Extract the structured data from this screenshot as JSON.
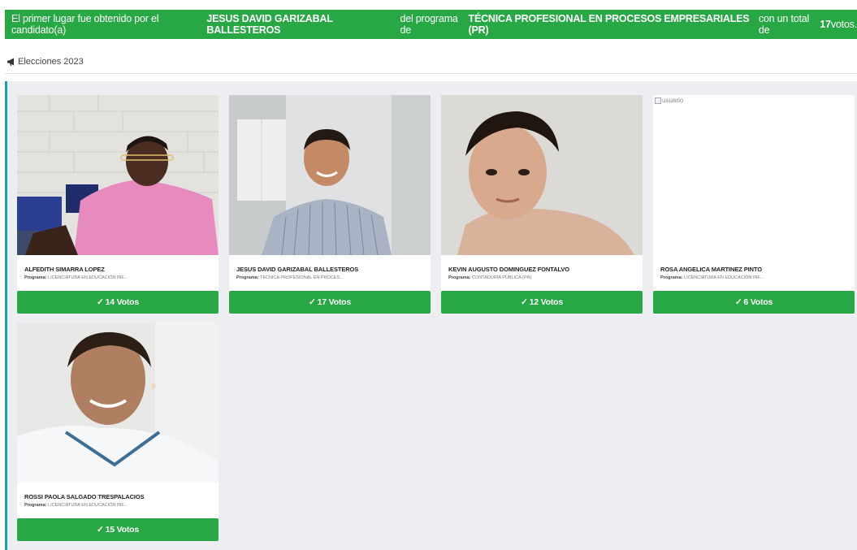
{
  "banner": {
    "prefix": "El primer lugar fue obtenido por el candidato(a) ",
    "winner_name": "JESUS DAVID GARIZABAL BALLESTEROS",
    "middle": " del programa de ",
    "program": "TÉCNICA PROFESIONAL EN PROCESOS EMPRESARIALES (PR)",
    "suffix_before": " con un total de ",
    "votes": "17",
    "suffix_after": " votos."
  },
  "breadcrumb": {
    "icon": "megaphone-icon",
    "label": "Elecciones 2023"
  },
  "program_label": "Programa:",
  "candidates": [
    {
      "name": "ALFEDITH SIMARRA LOPEZ",
      "program": "LICENCIATURA EN EDUCACIÓN INF...",
      "votes": "14 Votos",
      "photo": "candidate-photo"
    },
    {
      "name": "JESUS DAVID GARIZABAL BALLESTEROS",
      "program": "TÉCNICA PROFESIONAL EN PROCES...",
      "votes": "17 Votos",
      "photo": "candidate-photo"
    },
    {
      "name": "KEVIN AUGUSTO DOMINGUEZ FONTALVO",
      "program": "CONTADURÍA PÚBLICA (PR)",
      "votes": "12 Votos",
      "photo": "candidate-photo"
    },
    {
      "name": "ROSA ANGELICA MARTINEZ PINTO",
      "program": "LICENCIATURA EN EDUCACIÓN INF...",
      "votes": "6 Votos",
      "photo": "broken-image",
      "alt": "usuario"
    },
    {
      "name": "ROSSI PAOLA SALGADO TRESPALACIOS",
      "program": "LICENCIATURA EN EDUCACIÓN INF...",
      "votes": "15 Votos",
      "photo": "candidate-photo"
    }
  ],
  "colors": {
    "success": "#28a745",
    "panel_bg": "#eceef1",
    "panel_accent": "#18a0b0"
  }
}
